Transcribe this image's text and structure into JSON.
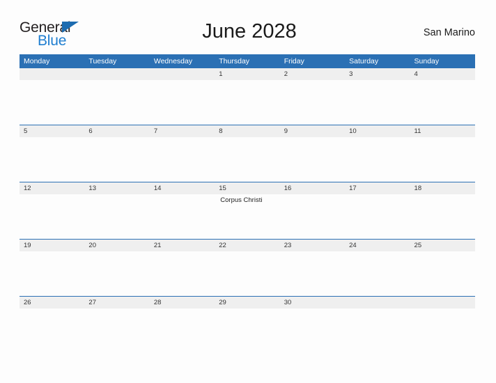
{
  "brand": {
    "name_part1": "General",
    "name_part2": "Blue",
    "triangle_icon": "triangle-right-icon",
    "color_dark": "#231f20",
    "color_blue": "#1f7ed0",
    "color_triangle": "#1d6cb0"
  },
  "header": {
    "title": "June 2028",
    "country": "San Marino"
  },
  "theme": {
    "header_blue": "#2b70b4",
    "date_band": "#efefef",
    "page_background": "#fdfdfd",
    "text": "#1a1a1a"
  },
  "calendar": {
    "month": "June",
    "year": "2028",
    "weekday_headers": [
      "Monday",
      "Tuesday",
      "Wednesday",
      "Thursday",
      "Friday",
      "Saturday",
      "Sunday"
    ],
    "weeks": [
      {
        "days": [
          {
            "date": "",
            "event": ""
          },
          {
            "date": "",
            "event": ""
          },
          {
            "date": "",
            "event": ""
          },
          {
            "date": "1",
            "event": ""
          },
          {
            "date": "2",
            "event": ""
          },
          {
            "date": "3",
            "event": ""
          },
          {
            "date": "4",
            "event": ""
          }
        ]
      },
      {
        "days": [
          {
            "date": "5",
            "event": ""
          },
          {
            "date": "6",
            "event": ""
          },
          {
            "date": "7",
            "event": ""
          },
          {
            "date": "8",
            "event": ""
          },
          {
            "date": "9",
            "event": ""
          },
          {
            "date": "10",
            "event": ""
          },
          {
            "date": "11",
            "event": ""
          }
        ]
      },
      {
        "days": [
          {
            "date": "12",
            "event": ""
          },
          {
            "date": "13",
            "event": ""
          },
          {
            "date": "14",
            "event": ""
          },
          {
            "date": "15",
            "event": "Corpus Christi"
          },
          {
            "date": "16",
            "event": ""
          },
          {
            "date": "17",
            "event": ""
          },
          {
            "date": "18",
            "event": ""
          }
        ]
      },
      {
        "days": [
          {
            "date": "19",
            "event": ""
          },
          {
            "date": "20",
            "event": ""
          },
          {
            "date": "21",
            "event": ""
          },
          {
            "date": "22",
            "event": ""
          },
          {
            "date": "23",
            "event": ""
          },
          {
            "date": "24",
            "event": ""
          },
          {
            "date": "25",
            "event": ""
          }
        ]
      },
      {
        "days": [
          {
            "date": "26",
            "event": ""
          },
          {
            "date": "27",
            "event": ""
          },
          {
            "date": "28",
            "event": ""
          },
          {
            "date": "29",
            "event": ""
          },
          {
            "date": "30",
            "event": ""
          },
          {
            "date": "",
            "event": ""
          },
          {
            "date": "",
            "event": ""
          }
        ]
      }
    ]
  }
}
